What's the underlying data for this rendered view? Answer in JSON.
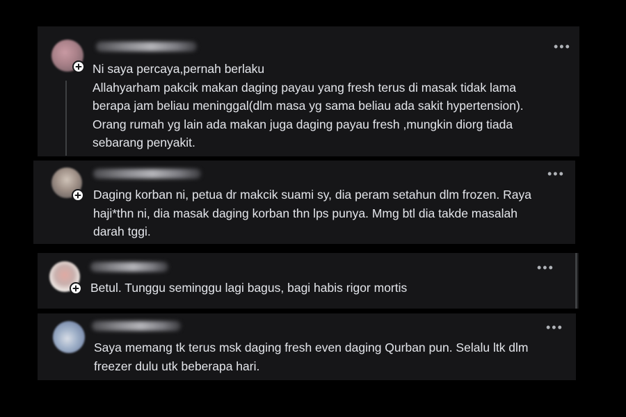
{
  "comments": [
    {
      "text": "Ni saya percaya,pernah berlaku\nAllahyarham pakcik makan daging payau yang fresh terus di masak tidak lama\nberapa jam beliau meninggal(dlm masa yg sama beliau ada sakit hypertension).\nOrang rumah yg lain ada makan juga daging payau fresh ,mungkin diorg tiada\nsebarang penyakit.",
      "more": "•••"
    },
    {
      "text": "Daging korban ni, petua dr makcik suami sy, dia peram setahun dlm frozen. Raya\nhaji*thn ni, dia masak daging korban thn lps punya. Mmg btl dia takde masalah\ndarah tggi.",
      "more": "•••"
    },
    {
      "text": "Betul. Tunggu seminggu lagi bagus, bagi habis rigor mortis",
      "more": "•••"
    },
    {
      "text": "Saya memang tk terus msk daging fresh even daging Qurban pun. Selalu ltk dlm\nfreezer dulu utk beberapa hari.",
      "more": "•••"
    }
  ],
  "colors": {
    "background": "#000000",
    "card": "#161618",
    "text": "#e4e6eb",
    "muted": "#b0b3b8"
  },
  "icons": {
    "avatar_badge": "plus-icon",
    "menu": "more-options-icon"
  }
}
